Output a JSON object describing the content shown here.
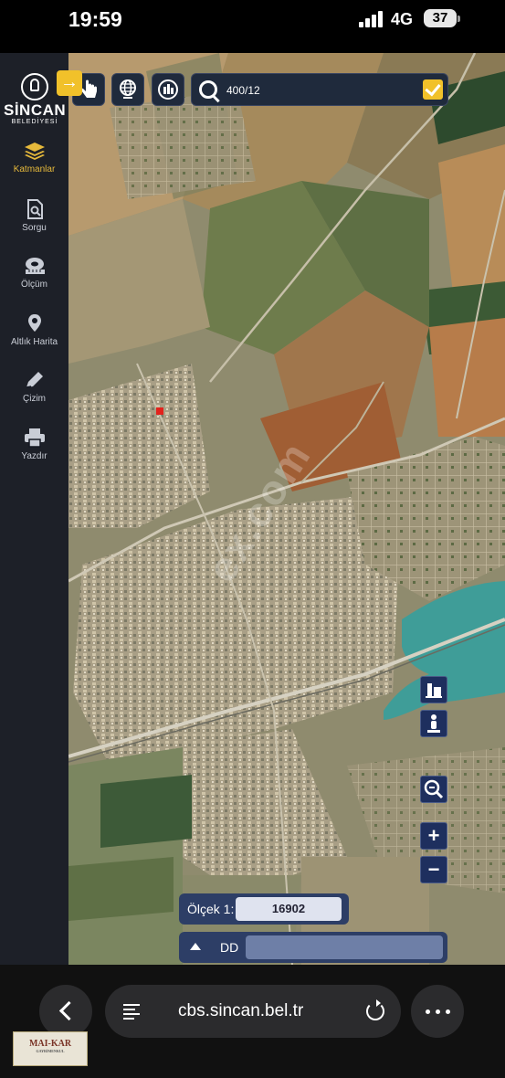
{
  "status_bar": {
    "time": "19:59",
    "network": "4G",
    "battery": "37"
  },
  "logo": {
    "name": "SİNCAN",
    "subtitle": "BELEDİYESİ"
  },
  "sidebar": {
    "items": [
      {
        "label": "Katmanlar",
        "icon": "layers-icon",
        "active": true
      },
      {
        "label": "Sorgu",
        "icon": "query-document-icon",
        "active": false
      },
      {
        "label": "Ölçüm",
        "icon": "ruler-tape-icon",
        "active": false
      },
      {
        "label": "Altlık Harita",
        "icon": "basemap-pin-icon",
        "active": false
      },
      {
        "label": "Çizim",
        "icon": "pencil-icon",
        "active": false
      },
      {
        "label": "Yazdır",
        "icon": "printer-icon",
        "active": false
      }
    ]
  },
  "toolbar": {
    "search_value": "400/12",
    "tools": [
      "hand-pointer-icon",
      "globe-icon",
      "building-icon"
    ]
  },
  "map": {
    "watermark": "ex.com",
    "controls": [
      "street-view-icon",
      "pegman-icon",
      "zoom-extent-icon",
      "zoom-in-icon",
      "zoom-out-icon"
    ]
  },
  "scale": {
    "label": "Ölçek 1:",
    "value": "16902"
  },
  "coordinates": {
    "label": "DD",
    "value": ""
  },
  "browser": {
    "url": "cbs.sincan.bel.tr"
  },
  "watermark_logo": {
    "text": "MAI-KAR",
    "subtext": "GAYRİMENKUL"
  },
  "colors": {
    "accent": "#f1c12a",
    "sidebar_bg": "#141822",
    "panel_blue": "#2d3e66",
    "water": "#3f9d98",
    "parcel_marker": "#e3221c"
  }
}
